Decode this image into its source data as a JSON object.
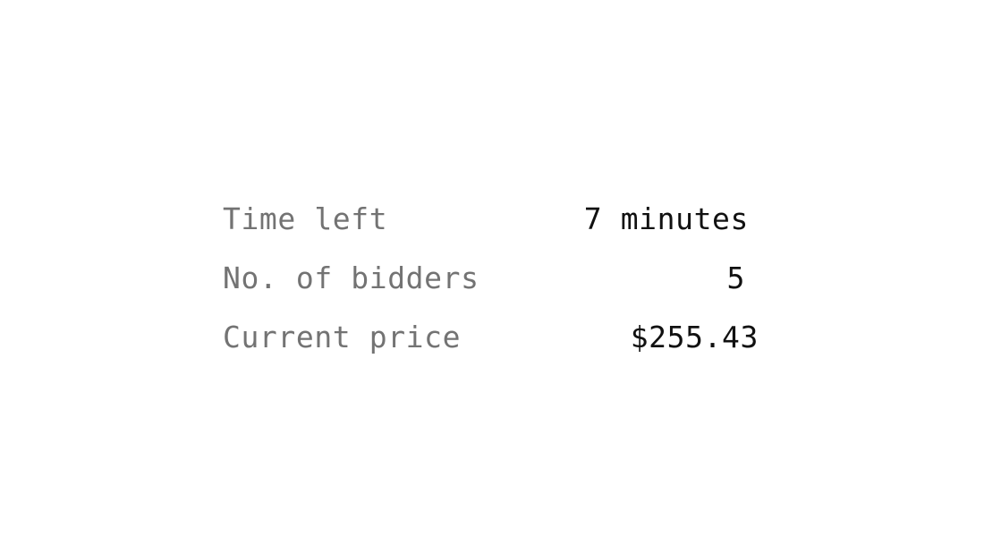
{
  "auction": {
    "time_left": {
      "label": "Time left",
      "value": "7 minutes"
    },
    "bidders": {
      "label": "No. of bidders",
      "value": "5"
    },
    "price": {
      "label": "Current price",
      "value": "$255.43"
    }
  },
  "colors": {
    "label_text": "#737373",
    "value_text": "#111111",
    "background": "#ffffff"
  }
}
